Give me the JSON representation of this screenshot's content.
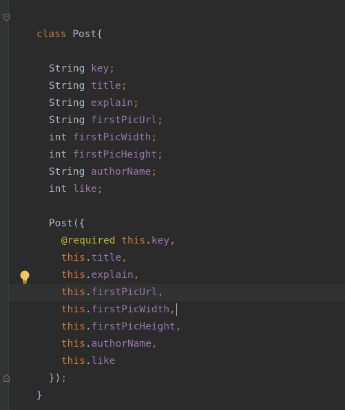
{
  "editor": {
    "class_decl": {
      "keyword": "class",
      "name": "Post",
      "brace": "{"
    },
    "fields": [
      {
        "type": "String",
        "name": "key",
        "semi": ";"
      },
      {
        "type": "String",
        "name": "title",
        "semi": ";"
      },
      {
        "type": "String",
        "name": "explain",
        "semi": ";"
      },
      {
        "type": "String",
        "name": "firstPicUrl",
        "semi": ";"
      },
      {
        "type": "int",
        "name": "firstPicWidth",
        "semi": ";"
      },
      {
        "type": "int",
        "name": "firstPicHeight",
        "semi": ";"
      },
      {
        "type": "String",
        "name": "authorName",
        "semi": ";"
      },
      {
        "type": "int",
        "name": "like",
        "semi": ";"
      }
    ],
    "constructor": {
      "open": "Post({",
      "required_annotation": "@required",
      "params": [
        {
          "this": "this",
          "dot": ".",
          "name": "key",
          "comma": ","
        },
        {
          "this": "this",
          "dot": ".",
          "name": "title",
          "comma": ","
        },
        {
          "this": "this",
          "dot": ".",
          "name": "explain",
          "comma": ","
        },
        {
          "this": "this",
          "dot": ".",
          "name": "firstPicUrl",
          "comma": ","
        },
        {
          "this": "this",
          "dot": ".",
          "name": "firstPicWidth",
          "comma": ","
        },
        {
          "this": "this",
          "dot": ".",
          "name": "firstPicHeight",
          "comma": ","
        },
        {
          "this": "this",
          "dot": ".",
          "name": "authorName",
          "comma": ","
        },
        {
          "this": "this",
          "dot": ".",
          "name": "like",
          "comma": ""
        }
      ],
      "close": "})",
      "close_semi": ";"
    },
    "class_close": "}",
    "colors": {
      "background": "#2b2b2b",
      "keyword": "#cc7832",
      "field": "#9876aa",
      "plain": "#a9b7c6",
      "annotation": "#bbb529",
      "bulb": "#f2c55c"
    },
    "icons": [
      "fold-marker-icon",
      "lightbulb-icon"
    ]
  }
}
